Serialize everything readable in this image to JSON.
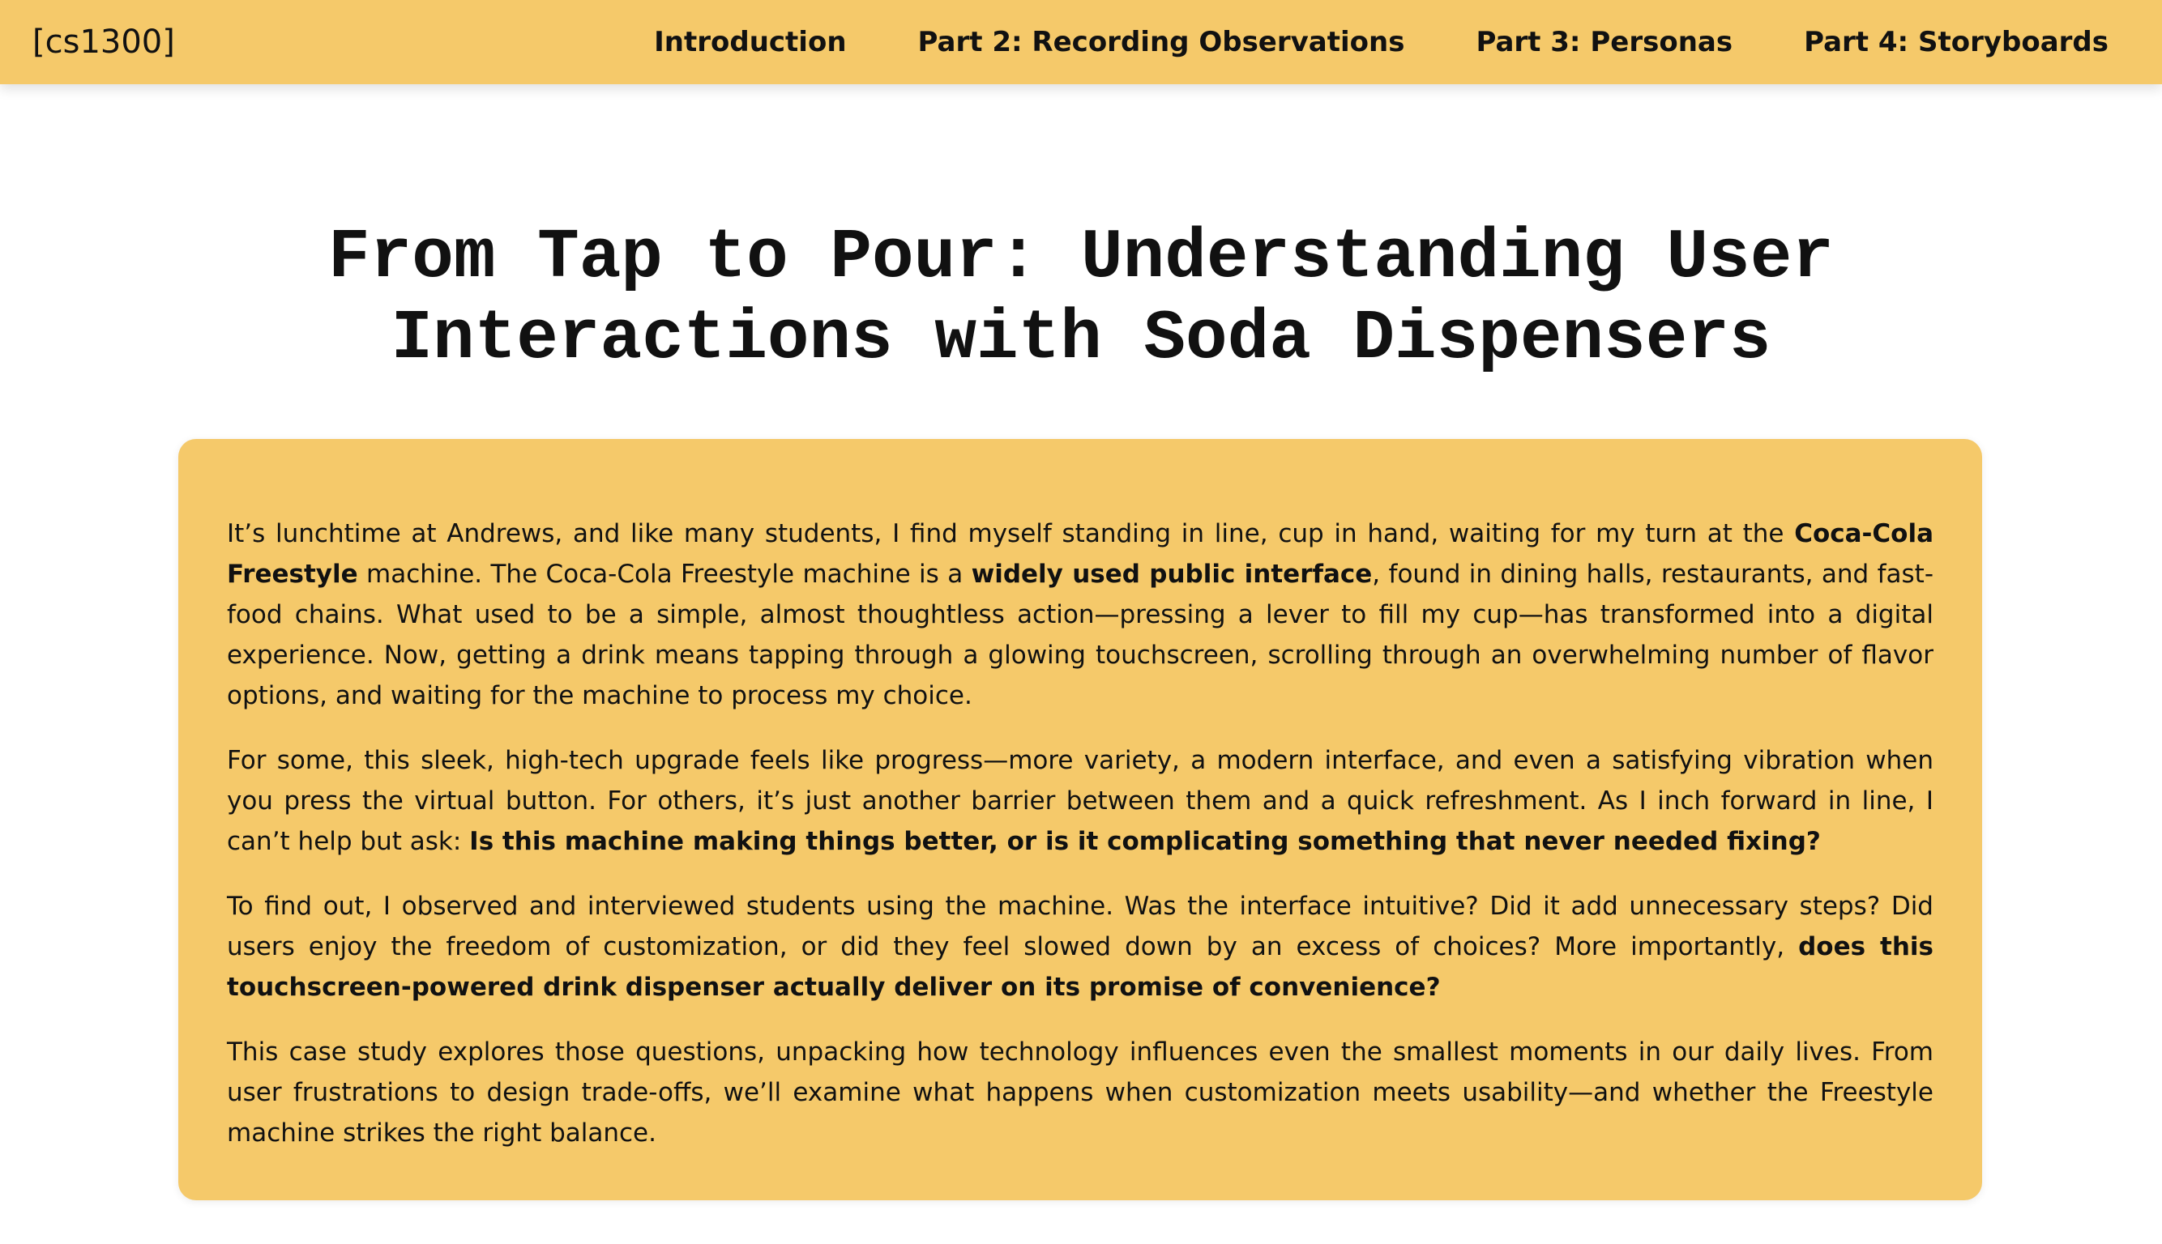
{
  "header": {
    "brand": "[cs1300]",
    "nav": [
      {
        "label": "Introduction"
      },
      {
        "label": "Part 2: Recording Observations"
      },
      {
        "label": "Part 3: Personas"
      },
      {
        "label": "Part 4: Storyboards"
      }
    ]
  },
  "main": {
    "title": "From Tap to Pour: Understanding User Interactions with Soda Dispensers",
    "paragraphs": [
      {
        "s1": "It’s lunchtime at Andrews, and like many students, I find myself standing in line, cup in hand, waiting for my turn at the ",
        "b1": "Coca-Cola Freestyle",
        "s2": " machine. The Coca-Cola Freestyle machine is a ",
        "b2": "widely used public interface",
        "s3": ", found in dining halls, restaurants, and fast-food chains. What used to be a simple, almost thoughtless action—pressing a lever to fill my cup—has transformed into a digital experience. Now, getting a drink means tapping through a glowing touchscreen, scrolling through an overwhelming number of flavor options, and waiting for the machine to process my choice."
      },
      {
        "s1": "For some, this sleek, high-tech upgrade feels like progress—more variety, a modern interface, and even a satisfying vibration when you press the virtual button. For others, it’s just another barrier between them and a quick refreshment. As I inch forward in line, I can’t help but ask: ",
        "b1": "Is this machine making things better, or is it complicating something that never needed fixing?"
      },
      {
        "s1": "To find out, I observed and interviewed students using the machine. Was the interface intuitive? Did it add unnecessary steps? Did users enjoy the freedom of customization, or did they feel slowed down by an excess of choices? More importantly, ",
        "b1": "does this touchscreen-powered drink dispenser actually deliver on its promise of convenience?"
      },
      {
        "s1": "This case study explores those questions, unpacking how technology influences even the smallest moments in our daily lives. From user frustrations to design trade-offs, we’ll examine what happens when customization meets usability—and whether the Freestyle machine strikes the right balance."
      }
    ]
  },
  "colors": {
    "accent": "#f5c96a",
    "text": "#111111",
    "background": "#ffffff"
  }
}
